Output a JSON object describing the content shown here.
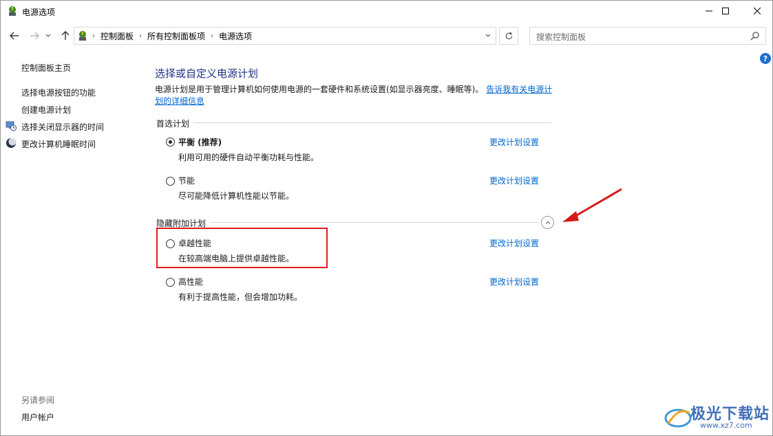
{
  "window": {
    "title": "电源选项"
  },
  "address": {
    "crumbs": [
      "控制面板",
      "所有控制面板项",
      "电源选项"
    ],
    "separator": "›"
  },
  "search": {
    "placeholder": "搜索控制面板"
  },
  "help": {
    "label": "?"
  },
  "sidebar": {
    "home": "控制面板主页",
    "items": [
      {
        "label": "选择电源按钮的功能",
        "icon": "none"
      },
      {
        "label": "创建电源计划",
        "icon": "none"
      },
      {
        "label": "选择关闭显示器的时间",
        "icon": "monitor-clock-icon"
      },
      {
        "label": "更改计算机睡眠时间",
        "icon": "moon-sleep-icon"
      }
    ],
    "see_also_label": "另请参阅",
    "see_also_items": [
      "用户帐户"
    ]
  },
  "main": {
    "title": "选择或自定义电源计划",
    "description": "电源计划是用于管理计算机如何使用电源的一套硬件和系统设置(如显示器亮度、睡眠等)。",
    "description_link": "告诉我有关电源计划的详细信息",
    "preferred_group_label": "首选计划",
    "hidden_group_label": "隐藏附加计划",
    "plans_preferred": [
      {
        "name": "平衡 (推荐)",
        "desc": "利用可用的硬件自动平衡功耗与性能。",
        "link": "更改计划设置",
        "selected": true
      },
      {
        "name": "节能",
        "desc": "尽可能降低计算机性能以节能。",
        "link": "更改计划设置",
        "selected": false
      }
    ],
    "plans_hidden": [
      {
        "name": "卓越性能",
        "desc": "在较高端电脑上提供卓越性能。",
        "link": "更改计划设置",
        "selected": false
      },
      {
        "name": "高性能",
        "desc": "有利于提高性能，但会增加功耗。",
        "link": "更改计划设置",
        "selected": false
      }
    ]
  },
  "watermark": {
    "text": "极光下载站",
    "url": "www.xz7.com"
  },
  "colors": {
    "title_blue": "#1e3287",
    "link_blue": "#0066cc",
    "highlight_red": "#e01c1c"
  }
}
